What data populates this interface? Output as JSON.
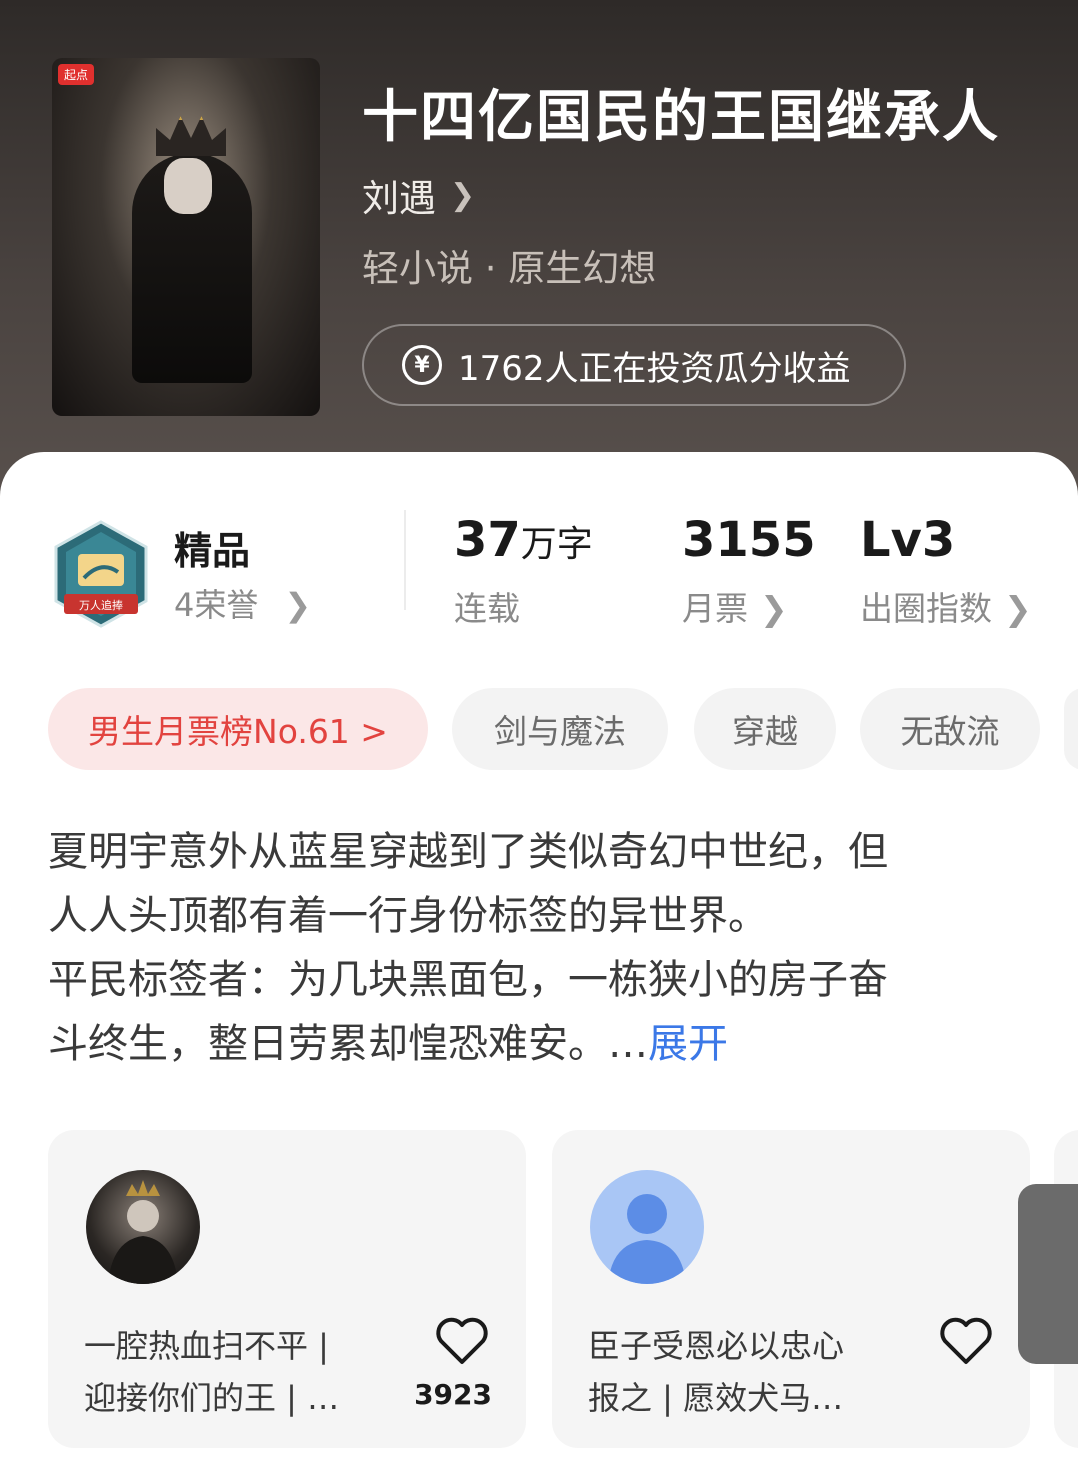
{
  "book": {
    "cover_badge": "起点",
    "title": "十四亿国民的王国继承人",
    "author": "刘遇",
    "genre": "轻小说 · 原生幻想",
    "invest_text": "1762人正在投资瓜分收益",
    "invest_icon": "yen-circle-icon"
  },
  "honor": {
    "title": "精品",
    "subtitle": "4荣誉",
    "medal_label": "万人追捧"
  },
  "stats": {
    "words_num": "37",
    "words_unit": "万字",
    "words_label": "连载",
    "votes_num": "3155",
    "votes_label": "月票",
    "level_num": "Lv3",
    "level_label": "出圈指数"
  },
  "tags": [
    "男生月票榜No.61 >",
    "剑与魔法",
    "穿越",
    "无敌流"
  ],
  "description": {
    "lines": [
      "夏明宇意外从蓝星穿越到了类似奇幻中世纪，但",
      "人人头顶都有着一行身份标签的异世界。",
      "平民标签者：为几块黑面包，一栋狭小的房子奋",
      "斗终生，整日劳累却惶恐难安。…"
    ],
    "more": "展开"
  },
  "reviews": [
    {
      "line1": "一腔热血扫不平 |",
      "line2": "迎接你们的王 | …",
      "likes": "3923"
    },
    {
      "line1": "臣子受恩必以忠心",
      "line2": "报之 | 愿效犬马…",
      "likes": ""
    }
  ],
  "colors": {
    "accent_red": "#e2433f",
    "link_blue": "#3b78e7"
  }
}
